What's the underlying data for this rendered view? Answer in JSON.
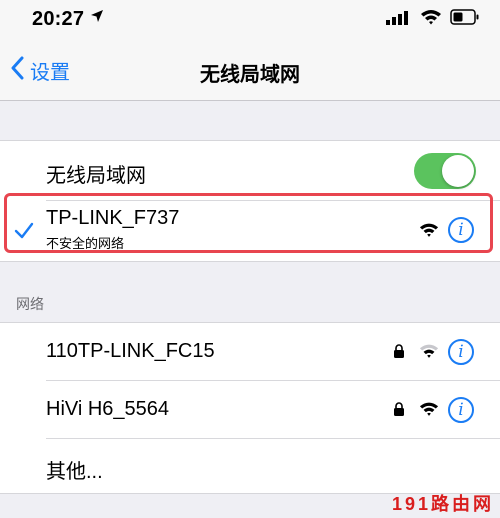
{
  "status_bar": {
    "time": "20:27"
  },
  "nav": {
    "back_label": "设置",
    "title": "无线局域网"
  },
  "wifi_toggle": {
    "label": "无线局域网",
    "enabled": true
  },
  "connected_network": {
    "name": "TP-LINK_F737",
    "subtitle": "不安全的网络",
    "secured": false
  },
  "networks_section": {
    "header": "网络",
    "items": [
      {
        "name": "110TP-LINK_FC15",
        "secured": true
      },
      {
        "name": "HiVi H6_5564",
        "secured": true
      }
    ],
    "other_label": "其他..."
  },
  "watermark": "191路由网",
  "colors": {
    "accent": "#1a7cf4",
    "toggle_on": "#5bc35e",
    "highlight": "#e8454f",
    "background": "#efeff4"
  },
  "icons": [
    "location-arrow-icon",
    "cellular-signal-icon",
    "wifi-status-icon",
    "battery-icon",
    "chevron-left-icon",
    "checkmark-icon",
    "wifi-signal-icon",
    "lock-icon",
    "info-icon"
  ]
}
